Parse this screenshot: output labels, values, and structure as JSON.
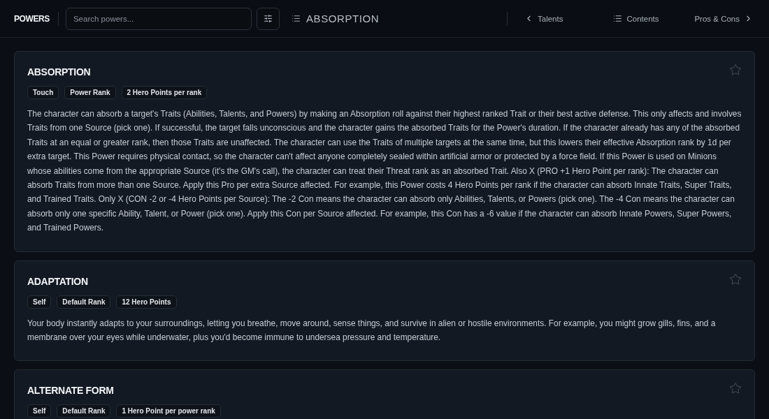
{
  "header": {
    "title": "POWERS",
    "search": {
      "placeholder": "Search powers..."
    },
    "current": "ABSORPTION",
    "nav": [
      {
        "kind": "prev",
        "label": "Talents"
      },
      {
        "kind": "contents",
        "label": "Contents"
      },
      {
        "kind": "next",
        "label": "Pros & Cons"
      }
    ]
  },
  "powers": [
    {
      "name": "ABSORPTION",
      "favorite": false,
      "tags": [
        "Touch",
        "Power Rank",
        "2 Hero Points per rank"
      ],
      "description": "The character can absorb a target's Traits (Abilities, Talents, and Powers) by making an Absorption roll against their highest ranked Trait or their best active defense. This only affects and involves Traits from one Source (pick one). If successful, the target falls unconscious and the character gains the absorbed Traits for the Power's duration. If the character already has any of the absorbed Traits at an equal or greater rank, then those Traits are unaffected. The character can use the Traits of multiple targets at the same time, but this lowers their effective Absorption rank by 1d per extra target. This Power requires physical contact, so the character can't affect anyone completely sealed within artificial armor or protected by a force field. If this Power is used on Minions whose abilities come from the appropriate Source (it's the GM's call), the character can treat their Threat rank as an absorbed Trait. Also X (PRO +1 Hero Point per rank): The character can absorb Traits from more than one Source. Apply this Pro per extra Source affected. For example, this Power costs 4 Hero Points per rank if the character can absorb Innate Traits, Super Traits, and Trained Traits. Only X (CON -2 or -4 Hero Points per Source): The -2 Con means the character can absorb only Abilities, Talents, or Powers (pick one). The -4 Con means the character can absorb only one specific Ability, Talent, or Power (pick one). Apply this Con per Source affected. For example, this Con has a -6 value if the character can absorb Innate Powers, Super Powers, and Trained Powers."
    },
    {
      "name": "ADAPTATION",
      "favorite": false,
      "tags": [
        "Self",
        "Default Rank",
        "12 Hero Points"
      ],
      "description": "Your body instantly adapts to your surroundings, letting you breathe, move around, sense things, and survive in alien or hostile environments. For example, you might grow gills, fins, and a membrane over your eyes while underwater, plus you'd become immune to undersea pressure and temperature."
    },
    {
      "name": "ALTERNATE FORM",
      "favorite": false,
      "tags": [
        "Self",
        "Default Rank",
        "1 Hero Point per power rank"
      ]
    }
  ]
}
